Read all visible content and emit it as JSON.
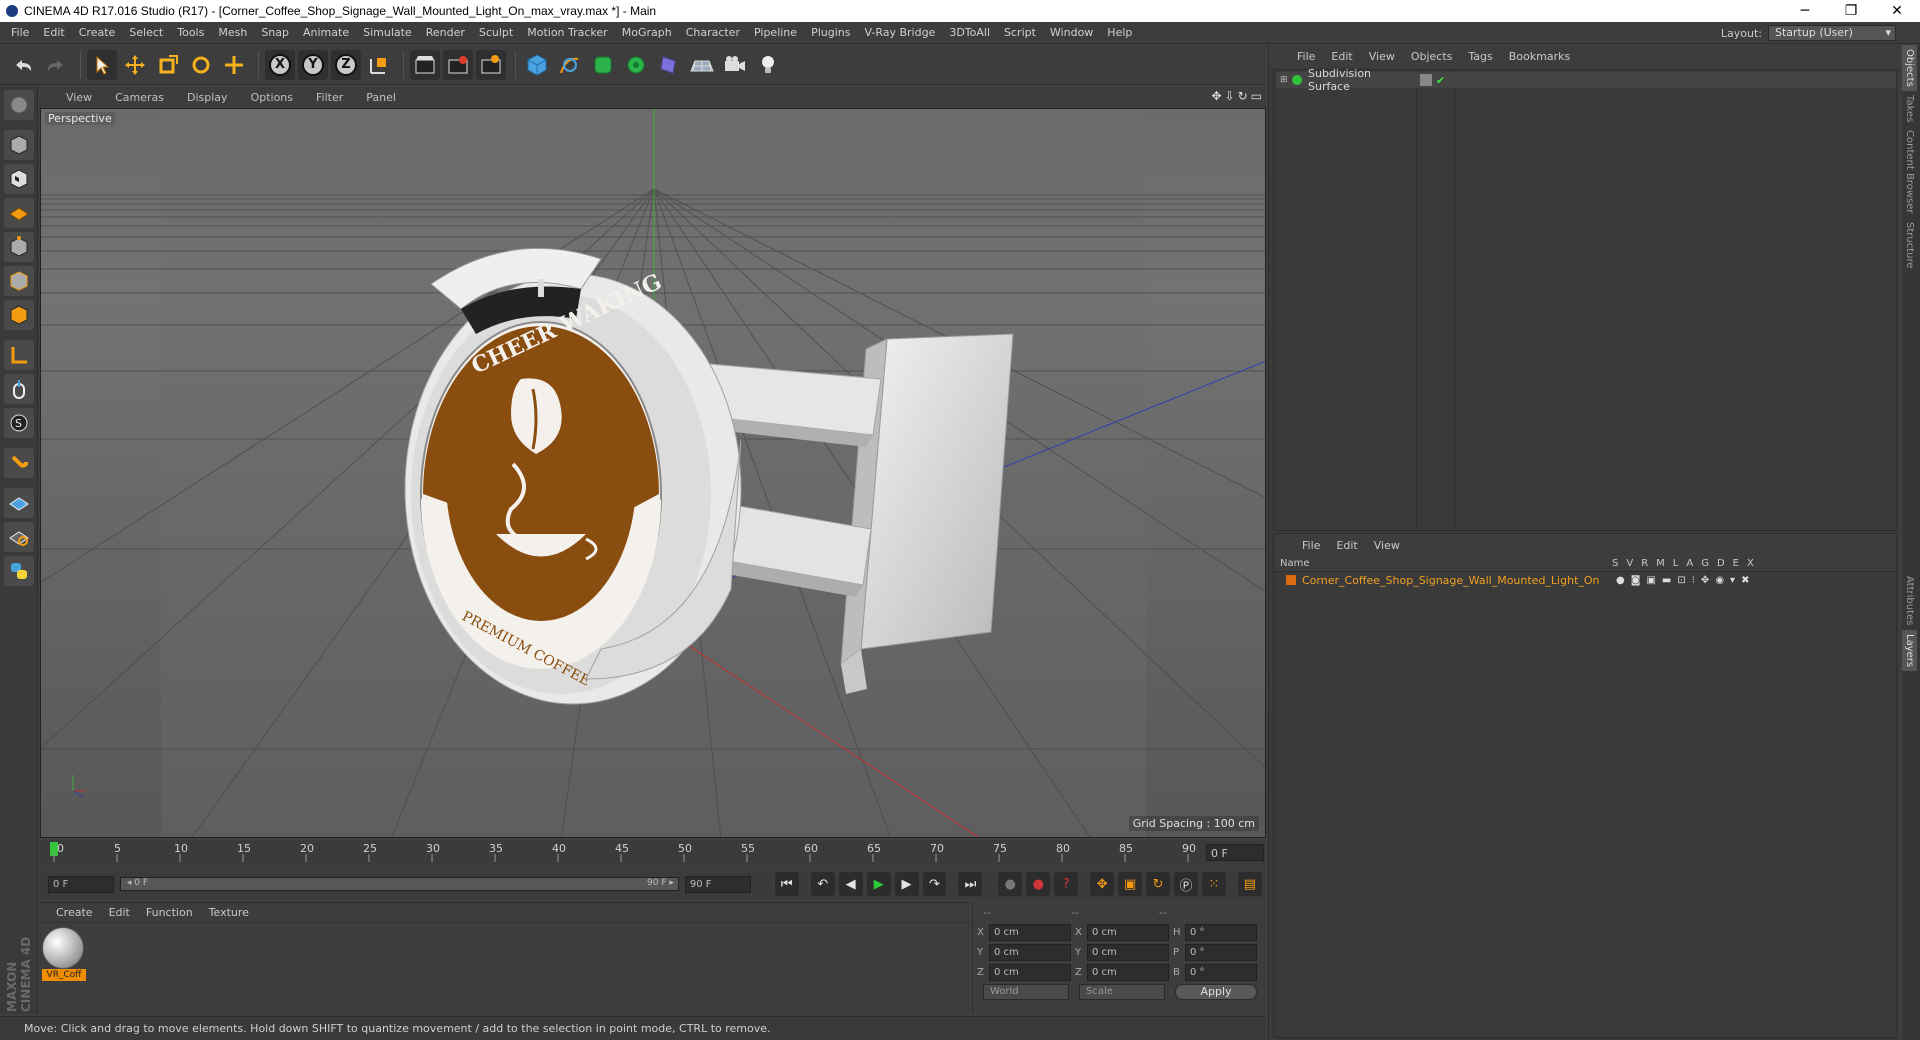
{
  "window": {
    "title": "CINEMA 4D R17.016 Studio (R17) - [Corner_Coffee_Shop_Signage_Wall_Mounted_Light_On_max_vray.max *] - Main",
    "minimize": "─",
    "restore": "❐",
    "close": "✕"
  },
  "menu": {
    "items": [
      "File",
      "Edit",
      "Create",
      "Select",
      "Tools",
      "Mesh",
      "Snap",
      "Animate",
      "Simulate",
      "Render",
      "Sculpt",
      "Motion Tracker",
      "MoGraph",
      "Character",
      "Pipeline",
      "Plugins",
      "V-Ray Bridge",
      "3DToAll",
      "Script",
      "Window",
      "Help"
    ],
    "layout_label": "Layout:",
    "layout_value": "Startup (User)"
  },
  "toolbar": {
    "axis_x": "X",
    "axis_y": "Y",
    "axis_z": "Z"
  },
  "viewport": {
    "menu": [
      "View",
      "Cameras",
      "Display",
      "Options",
      "Filter",
      "Panel"
    ],
    "label": "Perspective",
    "grid_spacing": "Grid Spacing : 100 cm",
    "nav_icons": [
      "✥",
      "⇩",
      "↻",
      "▭"
    ],
    "sign": {
      "top_text": "CHEER WAKING",
      "bottom_text": "PREMIUM COFFEE"
    }
  },
  "timeline": {
    "ticks": [
      "0",
      "5",
      "10",
      "15",
      "20",
      "25",
      "30",
      "35",
      "40",
      "45",
      "50",
      "55",
      "60",
      "65",
      "70",
      "75",
      "80",
      "85",
      "90"
    ],
    "current_frame": "0 F"
  },
  "transport": {
    "start": "0 F",
    "range_start": "◂ 0 F",
    "range_end": "90 F ▸",
    "end": "90 F"
  },
  "material_panel": {
    "menu": [
      "Create",
      "Edit",
      "Function",
      "Texture"
    ],
    "material_name": "VR_Coff"
  },
  "coordinates": {
    "headers": [
      "--",
      "--",
      "--"
    ],
    "rows": [
      {
        "a": "X",
        "av": "0 cm",
        "b": "X",
        "bv": "0 cm",
        "c": "H",
        "cv": "0 °"
      },
      {
        "a": "Y",
        "av": "0 cm",
        "b": "Y",
        "bv": "0 cm",
        "c": "P",
        "cv": "0 °"
      },
      {
        "a": "Z",
        "av": "0 cm",
        "b": "Z",
        "bv": "0 cm",
        "c": "B",
        "cv": "0 °"
      }
    ],
    "space": "World",
    "mode": "Scale",
    "apply": "Apply"
  },
  "status": {
    "text": "Move: Click and drag to move elements. Hold down SHIFT to quantize movement / add to the selection in point mode, CTRL to remove."
  },
  "maxon": "MAXON CINEMA 4D",
  "objects_panel": {
    "menu": [
      "File",
      "Edit",
      "View",
      "Objects",
      "Tags",
      "Bookmarks"
    ],
    "object_name": "Subdivision Surface"
  },
  "layers_panel": {
    "menu": [
      "File",
      "Edit",
      "View"
    ],
    "col_name": "Name",
    "cols": [
      "S",
      "V",
      "R",
      "M",
      "L",
      "A",
      "G",
      "D",
      "E",
      "X"
    ],
    "layer_name": "Corner_Coffee_Shop_Signage_Wall_Mounted_Light_On"
  },
  "side_tabs": [
    "Objects",
    "Takes",
    "Content Browser",
    "Structure",
    "Attributes",
    "Layers"
  ]
}
